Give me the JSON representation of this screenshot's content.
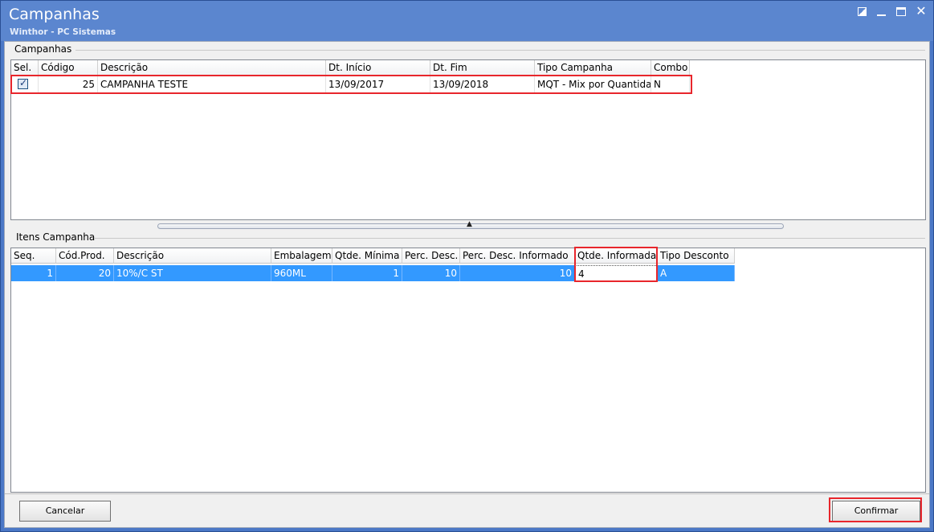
{
  "window": {
    "title": "Campanhas",
    "subtitle": "Winthor - PC Sistemas"
  },
  "campanhas": {
    "group_label": "Campanhas",
    "columns": [
      "Sel.",
      "Código",
      "Descrição",
      "Dt. Início",
      "Dt. Fim",
      "Tipo Campanha",
      "Combo"
    ],
    "rows": [
      {
        "sel": true,
        "codigo": "25",
        "descricao": "CAMPANHA TESTE",
        "dt_inicio": "13/09/2017",
        "dt_fim": "13/09/2018",
        "tipo": "MQT - Mix por Quantidad",
        "combo": "N"
      }
    ]
  },
  "itens": {
    "group_label": "Itens Campanha",
    "columns": [
      "Seq.",
      "Cód.Prod.",
      "Descrição",
      "Embalagem",
      "Qtde. Mínima",
      "Perc. Desc.",
      "Perc. Desc. Informado",
      "Qtde. Informada",
      "Tipo Desconto"
    ],
    "rows": [
      {
        "seq": "1",
        "cod_prod": "20",
        "descricao": "10%/C ST",
        "embalagem": "960ML",
        "qtde_minima": "1",
        "perc_desc": "10",
        "perc_desc_informado": "10",
        "qtde_informada": "4",
        "tipo_desconto": "A"
      }
    ]
  },
  "buttons": {
    "cancelar": "Cancelar",
    "confirmar": "Confirmar"
  },
  "colors": {
    "title_bar": "#5b86cf",
    "selection": "#3399ff",
    "highlight": "#e8262c"
  }
}
